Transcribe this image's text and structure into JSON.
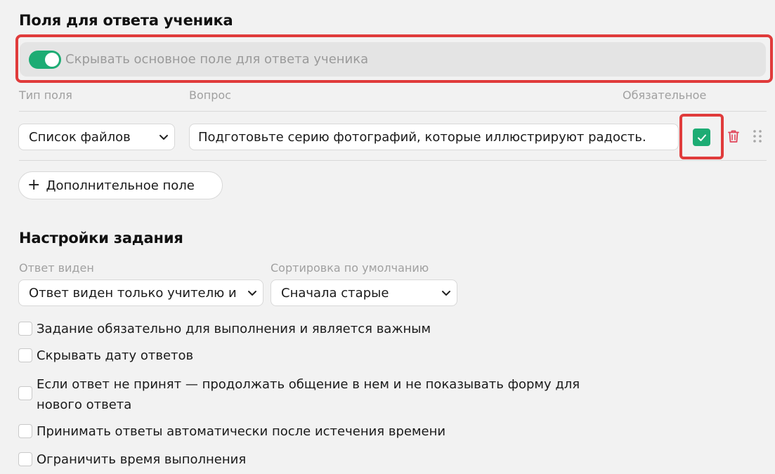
{
  "fields_section": {
    "title": "Поля для ответа ученика",
    "hide_main_field": {
      "label": "Скрывать основное поле для ответа ученика",
      "enabled": true
    },
    "columns": {
      "type": "Тип поля",
      "question": "Вопрос",
      "required": "Обязательное"
    },
    "rows": [
      {
        "type": "Список файлов",
        "question": "Подготовьте серию фотографий, которые иллюстрируют радость.",
        "required": true
      }
    ],
    "add_field_label": "Дополнительное поле"
  },
  "settings_section": {
    "title": "Настройки задания",
    "answer_visible": {
      "label": "Ответ виден",
      "value": "Ответ виден только учителю и"
    },
    "default_sort": {
      "label": "Сортировка по умолчанию",
      "value": "Сначала старые"
    },
    "options": [
      {
        "label": "Задание обязательно для выполнения и является важным",
        "checked": false
      },
      {
        "label": "Скрывать дату ответов",
        "checked": false
      },
      {
        "label": "Если ответ не принят — продолжать общение в нем и не показывать форму для нового ответа",
        "checked": false
      },
      {
        "label": "Принимать ответы автоматически после истечения времени",
        "checked": false
      },
      {
        "label": "Ограничить время выполнения",
        "checked": false
      }
    ]
  },
  "colors": {
    "accent": "#1dac74",
    "highlight": "#e03b3b",
    "delete": "#e0455a"
  },
  "icons": {
    "toggle": "toggle-switch-icon",
    "chevron": "chevron-down-icon",
    "check": "check-icon",
    "delete": "trash-icon",
    "drag": "drag-handle-icon",
    "add": "plus-icon"
  }
}
